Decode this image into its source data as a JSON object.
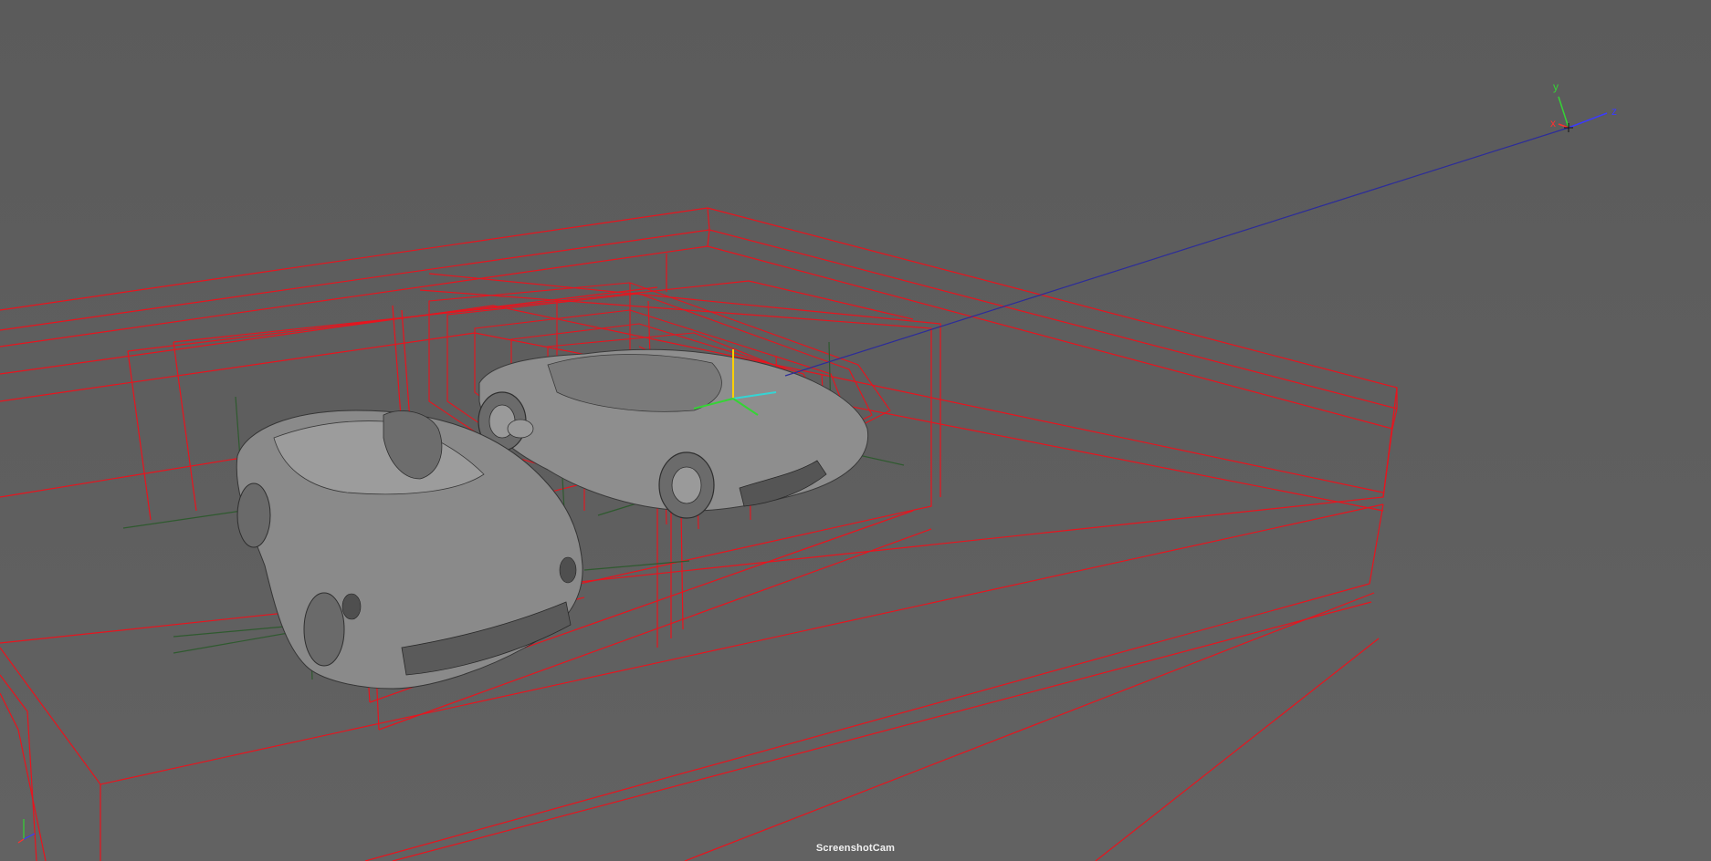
{
  "viewport": {
    "camera_label": "ScreenshotCam",
    "background_color": "#5d5d5d"
  },
  "view_cube_axes": {
    "x_label": "x",
    "y_label": "y",
    "z_label": "z",
    "x_color": "#ff3030",
    "y_color": "#35d435",
    "z_color": "#3a3aff"
  },
  "corner_axes": {
    "x_color": "#ff3030",
    "y_color": "#35d435",
    "z_color": "#3a3aff"
  },
  "scene": {
    "objects": [
      "car-model-front",
      "car-model-rear"
    ],
    "bounding_box_color": "#e8141e",
    "pivot_line_color": "#2f5a2f",
    "selected_axis_colors": {
      "x": "#35d435",
      "y": "#ffd000",
      "z": "#35d4d4"
    }
  }
}
